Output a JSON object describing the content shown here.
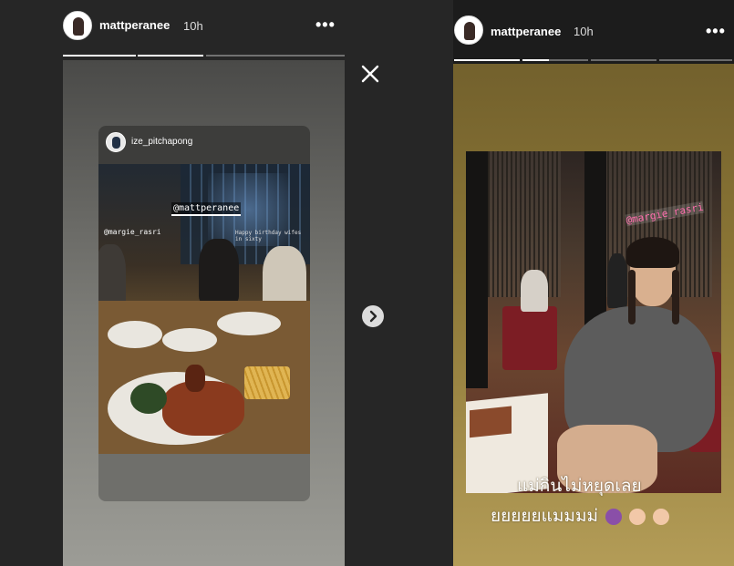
{
  "left_story": {
    "username": "mattperanee",
    "time": "10h",
    "menu_icon": "more-dots-icon",
    "progress": [
      1.0,
      1.0,
      0.0
    ],
    "shared_post": {
      "username": "ize_pitchapong",
      "mention_main": "@mattperanee",
      "mention_second": "@margie_rasri",
      "small_caption": "Happy birthday wifes in sixty"
    }
  },
  "right_story": {
    "username": "mattperanee",
    "time": "10h",
    "menu_icon": "more-dots-icon",
    "progress": [
      1.0,
      0.4,
      0.0,
      0.0
    ],
    "mention": "@margie_rasri",
    "caption_line1": "แม่กินไม่หยุดเลย",
    "caption_line2": "ยยยยยแมมมม่"
  },
  "controls": {
    "close_icon": "close-icon",
    "next_icon": "chevron-right-icon"
  },
  "colors": {
    "background": "#262626",
    "progress_fill": "#ffffff",
    "mention_pink": "#ff6fae"
  }
}
